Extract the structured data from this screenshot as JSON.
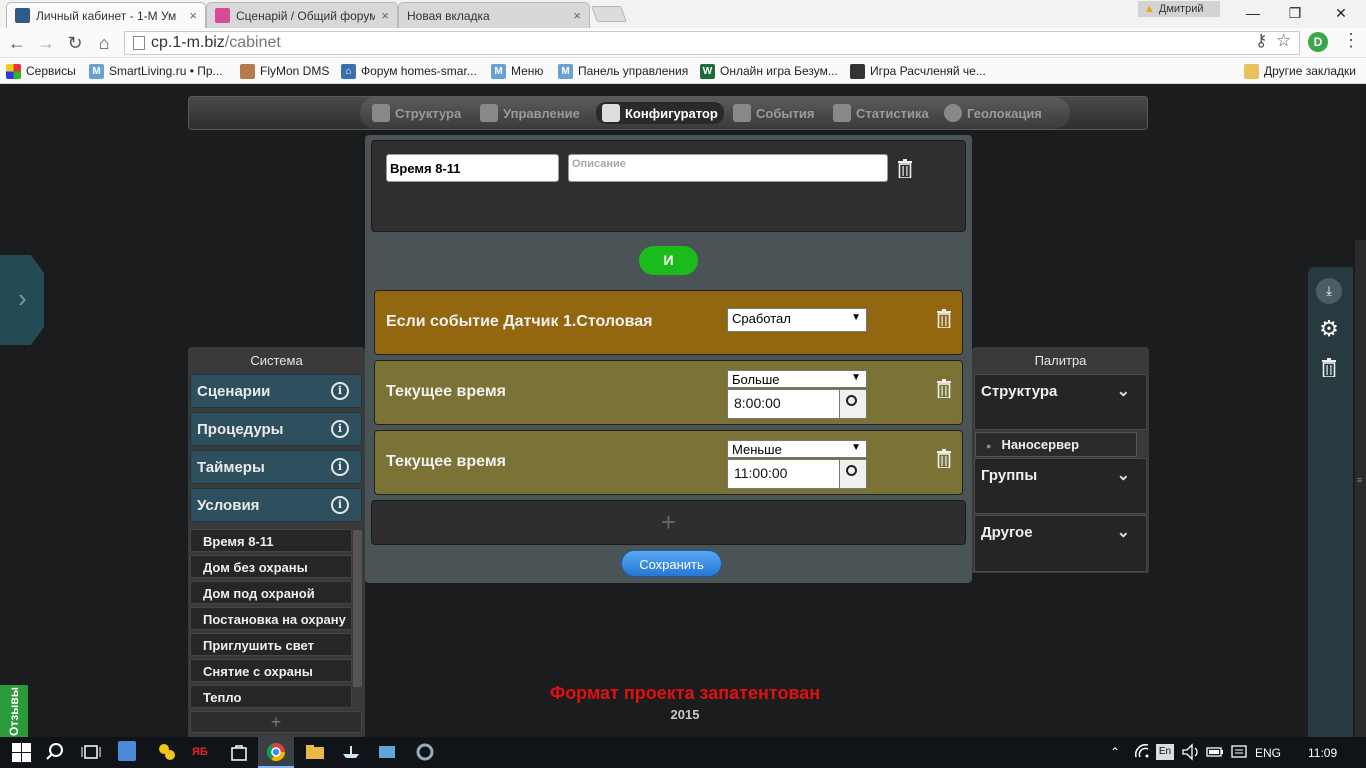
{
  "browser": {
    "tabs": [
      {
        "label": "Личный кабинет - 1-М Ум",
        "close": "×"
      },
      {
        "label": "Сценарій / Общий форум",
        "close": "×"
      },
      {
        "label": "Новая вкладка",
        "close": "×"
      }
    ],
    "profile_name": "Дмитрий",
    "window": {
      "minimize": "—",
      "restore": "❐",
      "close": "✕"
    },
    "nav": {
      "back": "←",
      "forward": "→",
      "reload": "↻",
      "home": "⌂"
    },
    "address": {
      "host": "cp.1-m.biz",
      "path": "/cabinet"
    },
    "omni_icons": {
      "key": "⚷",
      "star": "☆"
    },
    "extension_label": "D",
    "menu_icon": "⋮",
    "bookmarks": [
      {
        "label": "Сервисы"
      },
      {
        "label": "SmartLiving.ru • Пр..."
      },
      {
        "label": "FlyMon DMS"
      },
      {
        "label": "Форум homes-smar..."
      },
      {
        "label": "Меню"
      },
      {
        "label": "Панель управления"
      },
      {
        "label": "Онлайн игра Безум..."
      },
      {
        "label": "Игра Расчленяй че..."
      }
    ],
    "other_bookmarks": "Другие закладки"
  },
  "topmenu": {
    "items": [
      {
        "label": "Структура",
        "icon": "structure-icon"
      },
      {
        "label": "Управление",
        "icon": "gamepad-icon"
      },
      {
        "label": "Конфигуратор",
        "icon": "configurator-icon",
        "active": true
      },
      {
        "label": "События",
        "icon": "calendar-icon"
      },
      {
        "label": "Статистика",
        "icon": "chart-icon"
      },
      {
        "label": "Геолокация",
        "icon": "globe-icon"
      }
    ]
  },
  "side_arrow": "›",
  "system_panel": {
    "title": "Система",
    "categories": [
      {
        "label": "Сценарии",
        "info": "i"
      },
      {
        "label": "Процедуры",
        "info": "i"
      },
      {
        "label": "Таймеры",
        "info": "i"
      },
      {
        "label": "Условия",
        "info": "i"
      }
    ],
    "items": [
      "Время 8-11",
      "Дом без охраны",
      "Дом под охраной",
      "Постановка на охрану",
      "Приглушить свет",
      "Снятие с охраны",
      "Тепло"
    ],
    "add": "+"
  },
  "palette_panel": {
    "title": "Палитра",
    "categories": [
      {
        "label": "Структура",
        "chevron": "⌄"
      },
      {
        "label": "Группы",
        "chevron": "⌄"
      },
      {
        "label": "Другое",
        "chevron": "⌄"
      }
    ],
    "subitem": {
      "dot": "●",
      "label": "Наносервер"
    }
  },
  "editor": {
    "name_value": "Время 8-11",
    "description_placeholder": "Описание",
    "operator_label": "И",
    "conditions": [
      {
        "text": "Если событие Датчик 1.Столовая",
        "select": "Сработал",
        "time": null,
        "color": "#93670f"
      },
      {
        "text": "Текущее время",
        "select": "Больше",
        "time": "8:00:00",
        "color": "#7b7336"
      },
      {
        "text": "Текущее время",
        "select": "Меньше",
        "time": "11:00:00",
        "color": "#7b7336"
      }
    ],
    "select_arrow": "▼",
    "add_condition": "+",
    "save_label": "Сохранить"
  },
  "footer": {
    "title": "Формат проекта запатентован",
    "year": "2015"
  },
  "feedback_label": "Отзывы",
  "right_tools": {
    "download": "⤓",
    "gear": "⚙"
  },
  "taskbar": {
    "lang": "ENG",
    "time": "11:09",
    "ime": "En"
  },
  "colors": {
    "accent_green": "#1bbb1b",
    "save_blue": "#2477d4",
    "panel_blue": "#2d4f5e",
    "event_orange": "#93670f",
    "time_olive": "#7b7336",
    "footer_red": "#e01010"
  }
}
